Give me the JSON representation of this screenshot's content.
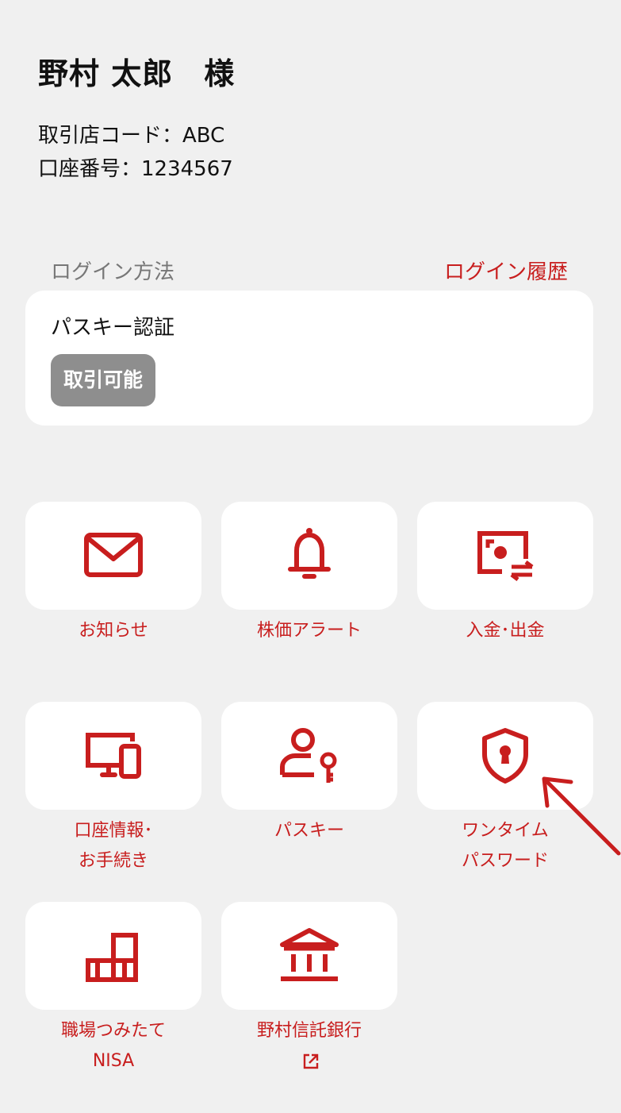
{
  "user": {
    "name": "野村 太郎　様",
    "branch_code": "取引店コード：ABC",
    "account_number": "口座番号：1234567"
  },
  "login": {
    "method_label": "ログイン方法",
    "history_link": "ログイン履歴",
    "method_name": "パスキー認証",
    "status_badge": "取引可能"
  },
  "menu": {
    "notifications": "お知らせ",
    "stock_alert": "株価アラート",
    "deposit_withdraw": "入金･出金",
    "account_info_1": "口座情報･",
    "account_info_2": "お手続き",
    "passkey": "パスキー",
    "onetime_1": "ワンタイム",
    "onetime_2": "パスワード",
    "workplace_1": "職場つみたて",
    "workplace_2": "NISA",
    "trust_bank": "野村信託銀行"
  },
  "icons": {
    "notifications": "mail-icon",
    "stock_alert": "bell-icon",
    "deposit_withdraw": "money-transfer-icon",
    "account_info": "devices-icon",
    "passkey": "user-key-icon",
    "onetime": "shield-lock-icon",
    "workplace": "blocks-icon",
    "trust_bank": "bank-icon",
    "external": "external-link-icon"
  },
  "colors": {
    "accent": "#c81e1e",
    "background": "#f0f0f0",
    "card": "#ffffff",
    "badge": "#8e8e8e"
  }
}
